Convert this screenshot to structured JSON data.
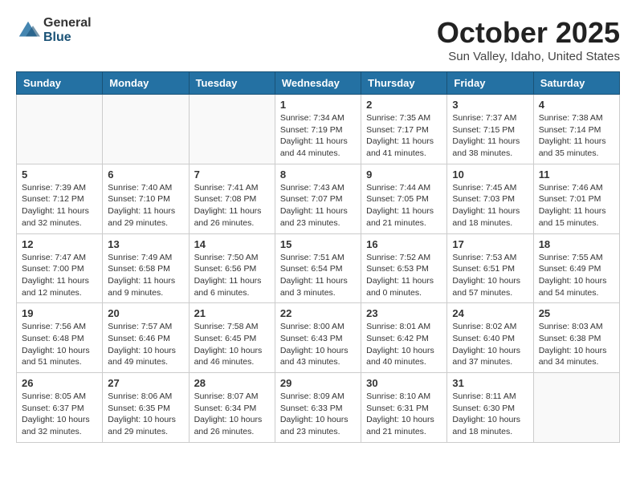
{
  "logo": {
    "general": "General",
    "blue": "Blue"
  },
  "title": "October 2025",
  "location": "Sun Valley, Idaho, United States",
  "days_header": [
    "Sunday",
    "Monday",
    "Tuesday",
    "Wednesday",
    "Thursday",
    "Friday",
    "Saturday"
  ],
  "weeks": [
    [
      {
        "day": "",
        "info": ""
      },
      {
        "day": "",
        "info": ""
      },
      {
        "day": "",
        "info": ""
      },
      {
        "day": "1",
        "info": "Sunrise: 7:34 AM\nSunset: 7:19 PM\nDaylight: 11 hours\nand 44 minutes."
      },
      {
        "day": "2",
        "info": "Sunrise: 7:35 AM\nSunset: 7:17 PM\nDaylight: 11 hours\nand 41 minutes."
      },
      {
        "day": "3",
        "info": "Sunrise: 7:37 AM\nSunset: 7:15 PM\nDaylight: 11 hours\nand 38 minutes."
      },
      {
        "day": "4",
        "info": "Sunrise: 7:38 AM\nSunset: 7:14 PM\nDaylight: 11 hours\nand 35 minutes."
      }
    ],
    [
      {
        "day": "5",
        "info": "Sunrise: 7:39 AM\nSunset: 7:12 PM\nDaylight: 11 hours\nand 32 minutes."
      },
      {
        "day": "6",
        "info": "Sunrise: 7:40 AM\nSunset: 7:10 PM\nDaylight: 11 hours\nand 29 minutes."
      },
      {
        "day": "7",
        "info": "Sunrise: 7:41 AM\nSunset: 7:08 PM\nDaylight: 11 hours\nand 26 minutes."
      },
      {
        "day": "8",
        "info": "Sunrise: 7:43 AM\nSunset: 7:07 PM\nDaylight: 11 hours\nand 23 minutes."
      },
      {
        "day": "9",
        "info": "Sunrise: 7:44 AM\nSunset: 7:05 PM\nDaylight: 11 hours\nand 21 minutes."
      },
      {
        "day": "10",
        "info": "Sunrise: 7:45 AM\nSunset: 7:03 PM\nDaylight: 11 hours\nand 18 minutes."
      },
      {
        "day": "11",
        "info": "Sunrise: 7:46 AM\nSunset: 7:01 PM\nDaylight: 11 hours\nand 15 minutes."
      }
    ],
    [
      {
        "day": "12",
        "info": "Sunrise: 7:47 AM\nSunset: 7:00 PM\nDaylight: 11 hours\nand 12 minutes."
      },
      {
        "day": "13",
        "info": "Sunrise: 7:49 AM\nSunset: 6:58 PM\nDaylight: 11 hours\nand 9 minutes."
      },
      {
        "day": "14",
        "info": "Sunrise: 7:50 AM\nSunset: 6:56 PM\nDaylight: 11 hours\nand 6 minutes."
      },
      {
        "day": "15",
        "info": "Sunrise: 7:51 AM\nSunset: 6:54 PM\nDaylight: 11 hours\nand 3 minutes."
      },
      {
        "day": "16",
        "info": "Sunrise: 7:52 AM\nSunset: 6:53 PM\nDaylight: 11 hours\nand 0 minutes."
      },
      {
        "day": "17",
        "info": "Sunrise: 7:53 AM\nSunset: 6:51 PM\nDaylight: 10 hours\nand 57 minutes."
      },
      {
        "day": "18",
        "info": "Sunrise: 7:55 AM\nSunset: 6:49 PM\nDaylight: 10 hours\nand 54 minutes."
      }
    ],
    [
      {
        "day": "19",
        "info": "Sunrise: 7:56 AM\nSunset: 6:48 PM\nDaylight: 10 hours\nand 51 minutes."
      },
      {
        "day": "20",
        "info": "Sunrise: 7:57 AM\nSunset: 6:46 PM\nDaylight: 10 hours\nand 49 minutes."
      },
      {
        "day": "21",
        "info": "Sunrise: 7:58 AM\nSunset: 6:45 PM\nDaylight: 10 hours\nand 46 minutes."
      },
      {
        "day": "22",
        "info": "Sunrise: 8:00 AM\nSunset: 6:43 PM\nDaylight: 10 hours\nand 43 minutes."
      },
      {
        "day": "23",
        "info": "Sunrise: 8:01 AM\nSunset: 6:42 PM\nDaylight: 10 hours\nand 40 minutes."
      },
      {
        "day": "24",
        "info": "Sunrise: 8:02 AM\nSunset: 6:40 PM\nDaylight: 10 hours\nand 37 minutes."
      },
      {
        "day": "25",
        "info": "Sunrise: 8:03 AM\nSunset: 6:38 PM\nDaylight: 10 hours\nand 34 minutes."
      }
    ],
    [
      {
        "day": "26",
        "info": "Sunrise: 8:05 AM\nSunset: 6:37 PM\nDaylight: 10 hours\nand 32 minutes."
      },
      {
        "day": "27",
        "info": "Sunrise: 8:06 AM\nSunset: 6:35 PM\nDaylight: 10 hours\nand 29 minutes."
      },
      {
        "day": "28",
        "info": "Sunrise: 8:07 AM\nSunset: 6:34 PM\nDaylight: 10 hours\nand 26 minutes."
      },
      {
        "day": "29",
        "info": "Sunrise: 8:09 AM\nSunset: 6:33 PM\nDaylight: 10 hours\nand 23 minutes."
      },
      {
        "day": "30",
        "info": "Sunrise: 8:10 AM\nSunset: 6:31 PM\nDaylight: 10 hours\nand 21 minutes."
      },
      {
        "day": "31",
        "info": "Sunrise: 8:11 AM\nSunset: 6:30 PM\nDaylight: 10 hours\nand 18 minutes."
      },
      {
        "day": "",
        "info": ""
      }
    ]
  ]
}
